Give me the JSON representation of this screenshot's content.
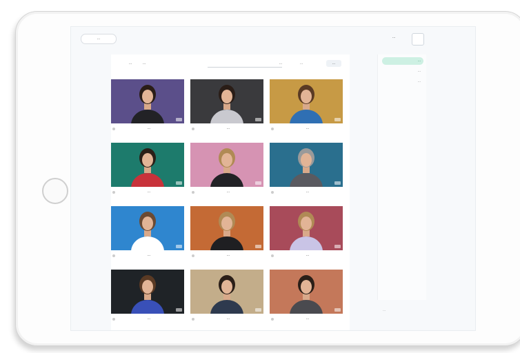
{
  "app": {
    "top_pill": "...",
    "user_label": "...",
    "search_label": "...",
    "filter_label": "...",
    "badge_label": "...",
    "side_bottom_label": "..."
  },
  "tabs": [
    {
      "label": "..."
    },
    {
      "label": "..."
    }
  ],
  "sidebar": {
    "items": [
      {
        "label": "...",
        "active": true
      },
      {
        "label": "..."
      },
      {
        "label": "..."
      }
    ]
  },
  "cards": [
    {
      "name": "...",
      "bg": "#5b4f8a",
      "shirt": "#222226",
      "hair": "#2a1d17"
    },
    {
      "name": "...",
      "bg": "#3a3a3d",
      "shirt": "#c9c9cf",
      "hair": "#2a1d17"
    },
    {
      "name": "...",
      "bg": "#c79a45",
      "shirt": "#2f6fb3",
      "hair": "#5a3a24"
    },
    {
      "name": "...",
      "bg": "#1d7b6c",
      "shirt": "#c8323a",
      "hair": "#2b1f18"
    },
    {
      "name": "...",
      "bg": "#d693b3",
      "shirt": "#222226",
      "hair": "#b08a55"
    },
    {
      "name": "...",
      "bg": "#2a6f8e",
      "shirt": "#5a5a60",
      "hair": "#9a9a9a"
    },
    {
      "name": "...",
      "bg": "#2f86cf",
      "shirt": "#ffffff",
      "hair": "#6b4a33"
    },
    {
      "name": "...",
      "bg": "#c46a35",
      "shirt": "#1f1f22",
      "hair": "#b08a55"
    },
    {
      "name": "...",
      "bg": "#a84b5a",
      "shirt": "#c9c4e6",
      "hair": "#b08a55"
    },
    {
      "name": "...",
      "bg": "#1f2327",
      "shirt": "#3950b8",
      "hair": "#5a3a24"
    },
    {
      "name": "...",
      "bg": "#c3ad8a",
      "shirt": "#2e3a4e",
      "hair": "#2b1f18"
    },
    {
      "name": "...",
      "bg": "#c4785a",
      "shirt": "#4a4a4f",
      "hair": "#2b1f18"
    }
  ]
}
